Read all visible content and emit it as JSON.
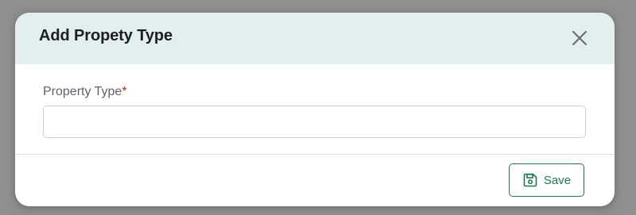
{
  "dialog": {
    "title": "Add Propety Type",
    "close_icon": "close-icon"
  },
  "form": {
    "field_label": "Property Type",
    "required_marker": "*",
    "field_value": "",
    "field_placeholder": ""
  },
  "footer": {
    "save_label": "Save",
    "save_icon": "floppy-disk-icon"
  },
  "colors": {
    "header_bg": "#e3eef0",
    "accent": "#1f7a4a",
    "required": "#c62828",
    "backdrop": "#8f8f8f"
  }
}
